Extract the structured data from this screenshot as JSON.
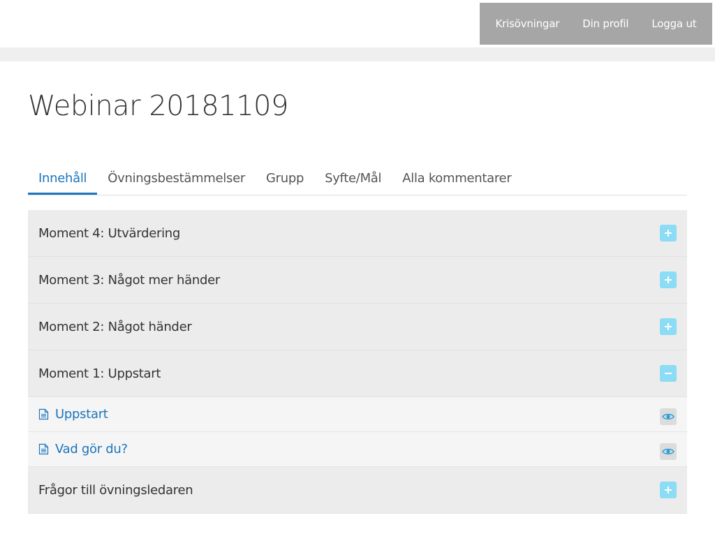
{
  "nav": {
    "items": [
      {
        "label": "Krisövningar"
      },
      {
        "label": "Din profil"
      },
      {
        "label": "Logga ut"
      }
    ]
  },
  "page": {
    "title": "Webinar 20181109"
  },
  "tabs": [
    {
      "label": "Innehåll",
      "active": true
    },
    {
      "label": "Övningsbestämmelser",
      "active": false
    },
    {
      "label": "Grupp",
      "active": false
    },
    {
      "label": "Syfte/Mål",
      "active": false
    },
    {
      "label": "Alla kommentarer",
      "active": false
    }
  ],
  "accordion": {
    "sections": [
      {
        "title": "Moment 4: Utvärdering",
        "expanded": false,
        "toggle_icon": "plus-icon"
      },
      {
        "title": "Moment 3: Något mer händer",
        "expanded": false,
        "toggle_icon": "plus-icon"
      },
      {
        "title": "Moment 2: Något händer",
        "expanded": false,
        "toggle_icon": "plus-icon"
      },
      {
        "title": "Moment 1: Uppstart",
        "expanded": true,
        "toggle_icon": "minus-icon",
        "items": [
          {
            "label": "Uppstart",
            "icon": "document-icon",
            "action_icon": "eye-icon"
          },
          {
            "label": "Vad gör du?",
            "icon": "document-icon",
            "action_icon": "eye-icon"
          }
        ]
      },
      {
        "title": "Frågor till övningsledaren",
        "expanded": false,
        "toggle_icon": "plus-icon"
      }
    ]
  },
  "colors": {
    "accent": "#1c75bc",
    "nav_background": "#a6a6a6",
    "toggle_button": "#8cdcf5",
    "accordion_header": "#ececec"
  }
}
